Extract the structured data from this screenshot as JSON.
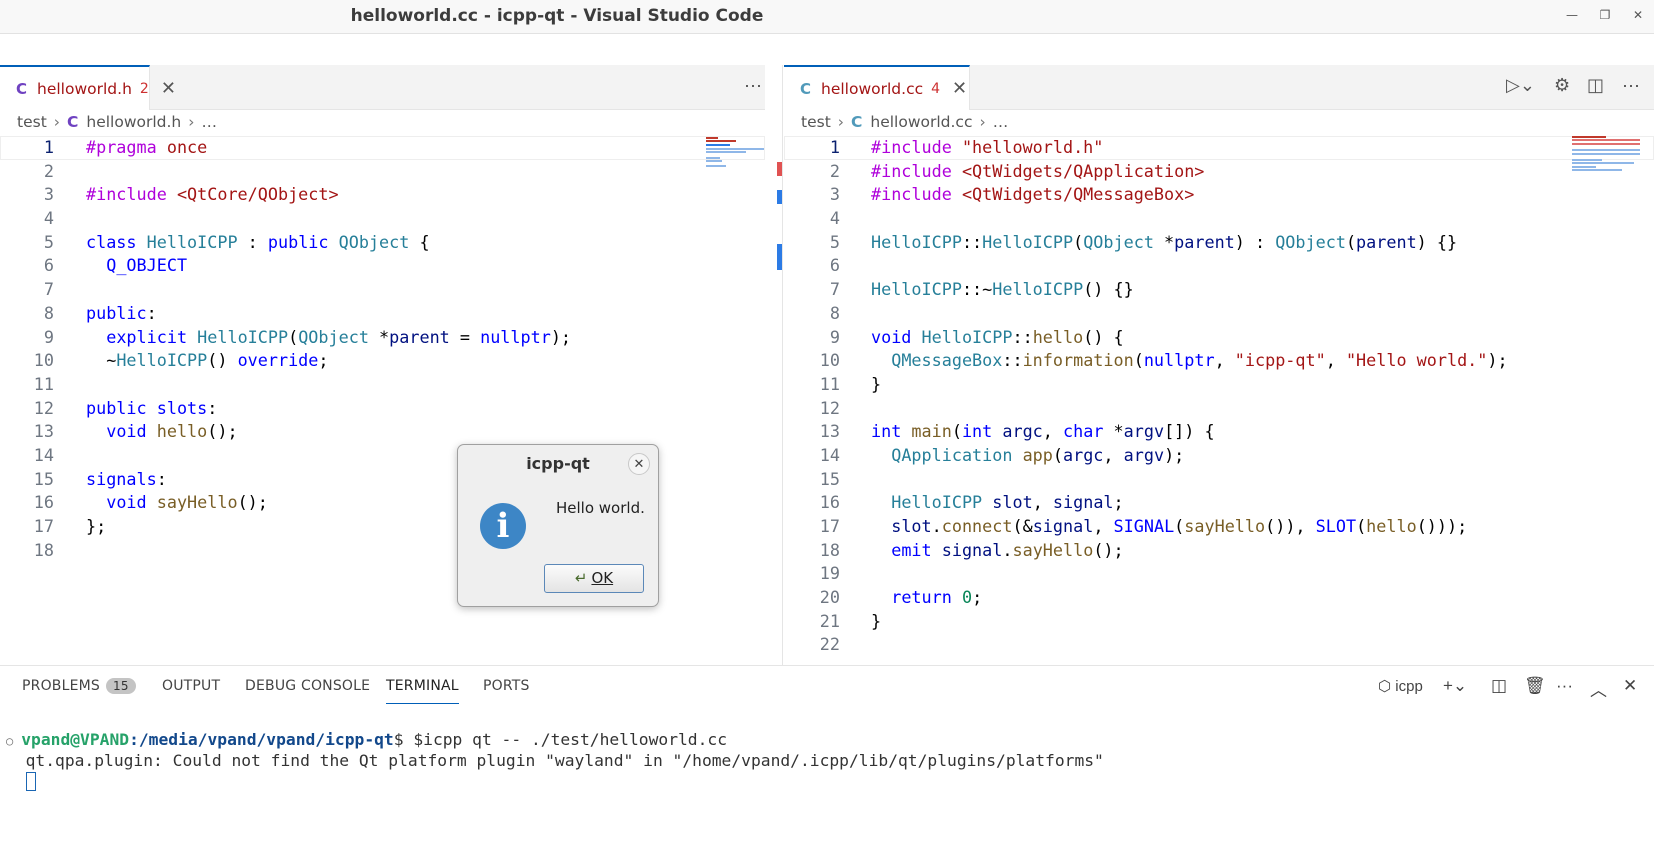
{
  "window": {
    "title": "helloworld.cc - icpp-qt - Visual Studio Code",
    "min": "—",
    "max": "❐",
    "close": "✕"
  },
  "left_pane": {
    "tab": {
      "icon": "C",
      "label": "helloworld.h",
      "badge": "2",
      "close": "✕"
    },
    "more": "···",
    "breadcrumb": {
      "folder": "test",
      "icon": "C",
      "file": "helloworld.h",
      "sep": "›",
      "ellipsis": "…"
    },
    "lines": [
      {
        "n": "1",
        "t": "#pragma once"
      },
      {
        "n": "2",
        "t": ""
      },
      {
        "n": "3",
        "t": "#include <QtCore/QObject>"
      },
      {
        "n": "4",
        "t": ""
      },
      {
        "n": "5",
        "t": "class HelloICPP : public QObject {"
      },
      {
        "n": "6",
        "t": "  Q_OBJECT"
      },
      {
        "n": "7",
        "t": ""
      },
      {
        "n": "8",
        "t": "public:"
      },
      {
        "n": "9",
        "t": "  explicit HelloICPP(QObject *parent = nullptr);"
      },
      {
        "n": "10",
        "t": "  ~HelloICPP() override;"
      },
      {
        "n": "11",
        "t": ""
      },
      {
        "n": "12",
        "t": "public slots:"
      },
      {
        "n": "13",
        "t": "  void hello();"
      },
      {
        "n": "14",
        "t": ""
      },
      {
        "n": "15",
        "t": "signals:"
      },
      {
        "n": "16",
        "t": "  void sayHello();"
      },
      {
        "n": "17",
        "t": "};"
      },
      {
        "n": "18",
        "t": ""
      }
    ]
  },
  "right_pane": {
    "tab": {
      "icon": "C",
      "label": "helloworld.cc",
      "badge": "4",
      "close": "✕"
    },
    "more": "···",
    "breadcrumb": {
      "folder": "test",
      "icon": "C",
      "file": "helloworld.cc",
      "sep": "›",
      "ellipsis": "…"
    },
    "lines": [
      {
        "n": "1",
        "t": "#include \"helloworld.h\""
      },
      {
        "n": "2",
        "t": "#include <QtWidgets/QApplication>"
      },
      {
        "n": "3",
        "t": "#include <QtWidgets/QMessageBox>"
      },
      {
        "n": "4",
        "t": ""
      },
      {
        "n": "5",
        "t": "HelloICPP::HelloICPP(QObject *parent) : QObject(parent) {}"
      },
      {
        "n": "6",
        "t": ""
      },
      {
        "n": "7",
        "t": "HelloICPP::~HelloICPP() {}"
      },
      {
        "n": "8",
        "t": ""
      },
      {
        "n": "9",
        "t": "void HelloICPP::hello() {"
      },
      {
        "n": "10",
        "t": "  QMessageBox::information(nullptr, \"icpp-qt\", \"Hello world.\");"
      },
      {
        "n": "11",
        "t": "}"
      },
      {
        "n": "12",
        "t": ""
      },
      {
        "n": "13",
        "t": "int main(int argc, char *argv[]) {"
      },
      {
        "n": "14",
        "t": "  QApplication app(argc, argv);"
      },
      {
        "n": "15",
        "t": ""
      },
      {
        "n": "16",
        "t": "  HelloICPP slot, signal;"
      },
      {
        "n": "17",
        "t": "  slot.connect(&signal, SIGNAL(sayHello()), SLOT(hello()));"
      },
      {
        "n": "18",
        "t": "  emit signal.sayHello();"
      },
      {
        "n": "19",
        "t": ""
      },
      {
        "n": "20",
        "t": "  return 0;"
      },
      {
        "n": "21",
        "t": "}"
      },
      {
        "n": "22",
        "t": ""
      }
    ]
  },
  "panel": {
    "tabs": {
      "problems": "PROBLEMS",
      "problems_count": "15",
      "output": "OUTPUT",
      "debug": "DEBUG CONSOLE",
      "terminal": "TERMINAL",
      "ports": "PORTS"
    },
    "terminal_name": "icpp",
    "terminal": {
      "user": "vpand@VPAND",
      "path": ":/media/vpand/vpand/icpp-qt",
      "command": "$ $icpp qt -- ./test/helloworld.cc",
      "output": "qt.qpa.plugin: Could not find the Qt platform plugin \"wayland\" in \"/home/vpand/.icpp/lib/qt/plugins/platforms\""
    }
  },
  "dialog": {
    "title": "icpp-qt",
    "message": "Hello world.",
    "ok": "OK",
    "close": "✕",
    "icon": "i"
  }
}
